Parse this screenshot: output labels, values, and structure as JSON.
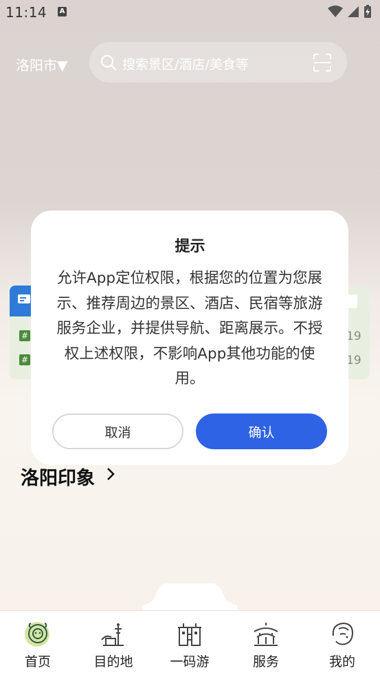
{
  "status_bar": {
    "time": "11:14",
    "notif_letter": "A"
  },
  "header": {
    "city": "洛阳市▼",
    "search_placeholder": "搜索景区/酒店/美食等"
  },
  "peek_cards": {
    "left_tag": "#",
    "right_num_1": "19",
    "right_num_2": "19"
  },
  "section": {
    "title": "洛阳印象"
  },
  "dialog": {
    "title": "提示",
    "message": "允许App定位权限，根据您的位置为您展示、推荐周边的景区、酒店、民宿等旅游服务企业，并提供导航、距离展示。不授权上述权限，不影响App其他功能的使用。",
    "cancel_label": "取消",
    "confirm_label": "确认"
  },
  "bottom_nav": {
    "items": [
      {
        "label": "首页",
        "icon": "home-lion-icon"
      },
      {
        "label": "目的地",
        "icon": "destination-icon"
      },
      {
        "label": "一码游",
        "icon": "gate-tower-icon"
      },
      {
        "label": "服务",
        "icon": "pavilion-icon"
      },
      {
        "label": "我的",
        "icon": "profile-face-icon"
      }
    ]
  },
  "colors": {
    "primary": "#2f63e6",
    "accent_green": "#4a8a3a"
  }
}
